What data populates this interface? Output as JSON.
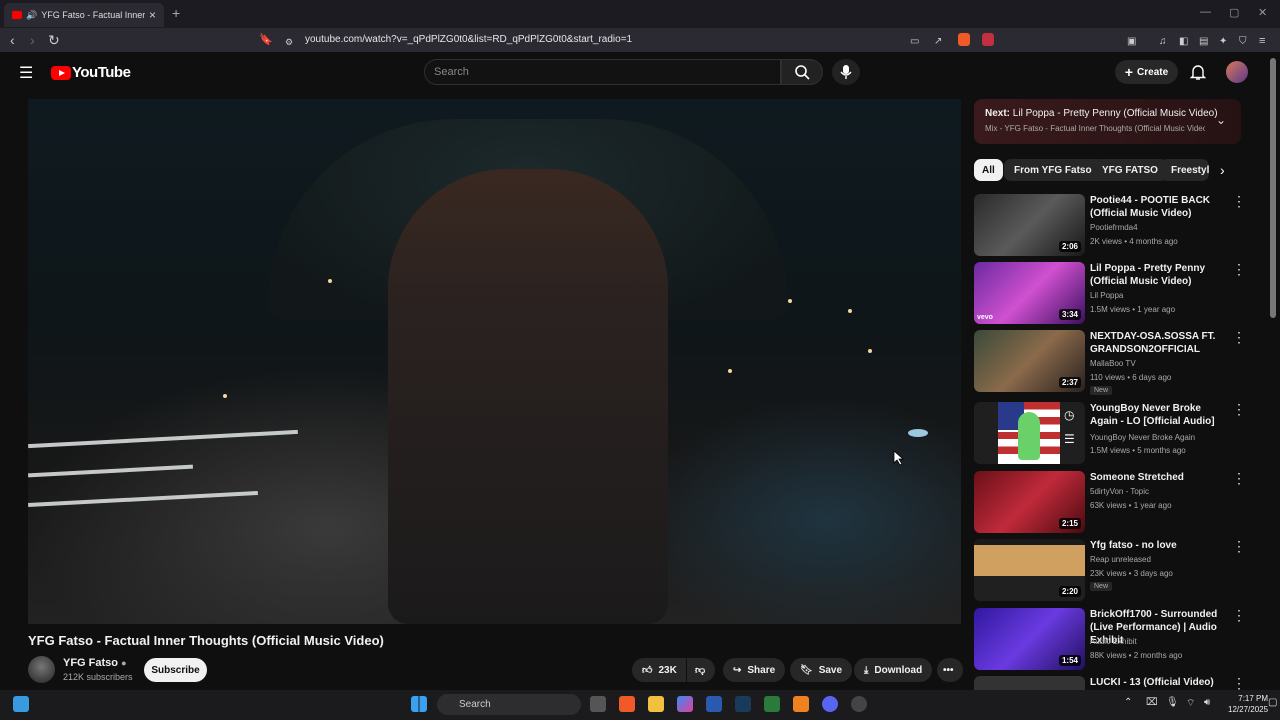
{
  "browser": {
    "tab_title": "YFG Fatso - Factual Inner Thoughts (Official Music Video) - YouTube",
    "new_tab": "+",
    "url": "youtube.com/watch?v=_qPdPlZG0t0&list=RD_qPdPlZG0t0&start_radio=1",
    "window_min": "—",
    "window_max": "▢",
    "window_close": "✕"
  },
  "youtube": {
    "logo_text": "YouTube",
    "search_placeholder": "Search",
    "create_label": "Create"
  },
  "video": {
    "title": "YFG Fatso - Factual Inner Thoughts (Official Music Video)",
    "channel": "YFG Fatso",
    "subscribers": "212K subscribers",
    "subscribe_label": "Subscribe",
    "likes": "23K",
    "share_label": "Share",
    "save_label": "Save",
    "download_label": "Download"
  },
  "next": {
    "prefix": "Next:",
    "title": "Lil Poppa - Pretty Penny (Official Music Video)",
    "playlist": "Mix - YFG Fatso - Factual Inner Thoughts (Official Music Video)"
  },
  "chips": [
    "All",
    "From YFG Fatso",
    "YFG FATSO",
    "Freestyle"
  ],
  "recommendations": [
    {
      "title": "Pootie44 - POOTIE BACK (Official Music Video)",
      "channel": "Pootiefrmda4",
      "meta": "2K views • 4 months ago",
      "duration": "2:06",
      "badge": "",
      "thumb": "#4b4b4b"
    },
    {
      "title": "Lil Poppa - Pretty Penny (Official Music Video)",
      "channel": "Lil Poppa",
      "meta": "1.5M views • 1 year ago",
      "duration": "3:34",
      "badge": "",
      "thumb": "#b03ac0"
    },
    {
      "title": "NEXTDAY-OSA.SOSSA FT. GRANDSON2OFFICIAL",
      "channel": "MallaBoo TV",
      "meta": "110 views • 6 days ago",
      "duration": "2:37",
      "badge": "New",
      "thumb": "#5a4a3a"
    },
    {
      "title": "YoungBoy Never Broke Again - LO [Official Audio]",
      "channel": "YoungBoy Never Broke Again",
      "meta": "1.5M views • 5 months ago",
      "duration": "",
      "badge": "",
      "thumb": "#303030"
    },
    {
      "title": "Someone Stretched",
      "channel": "5dirtyVon - Topic",
      "meta": "63K views • 1 year ago",
      "duration": "2:15",
      "badge": "",
      "thumb": "#a0202a"
    },
    {
      "title": "Yfg fatso - no love",
      "channel": "Reap unreleased",
      "meta": "23K views • 3 days ago",
      "duration": "2:20",
      "badge": "New",
      "thumb": "#222222"
    },
    {
      "title": "BrickOff1700 - Surrounded (Live Performance) | Audio Exhibit",
      "channel": "Audio Exhibit",
      "meta": "88K views • 2 months ago",
      "duration": "1:54",
      "badge": "",
      "thumb": "#4a2ab0"
    },
    {
      "title": "LUCKI - 13 (Official Video)",
      "channel": "",
      "meta": "",
      "duration": "",
      "badge": "",
      "thumb": "#333333"
    }
  ],
  "taskbar": {
    "search_label": "Search",
    "time": "7:17 PM",
    "date": "12/27/2025"
  },
  "colors": {
    "youtube_red": "#ff0000",
    "background": "#0f0f0f",
    "chip_bg": "#272727"
  }
}
